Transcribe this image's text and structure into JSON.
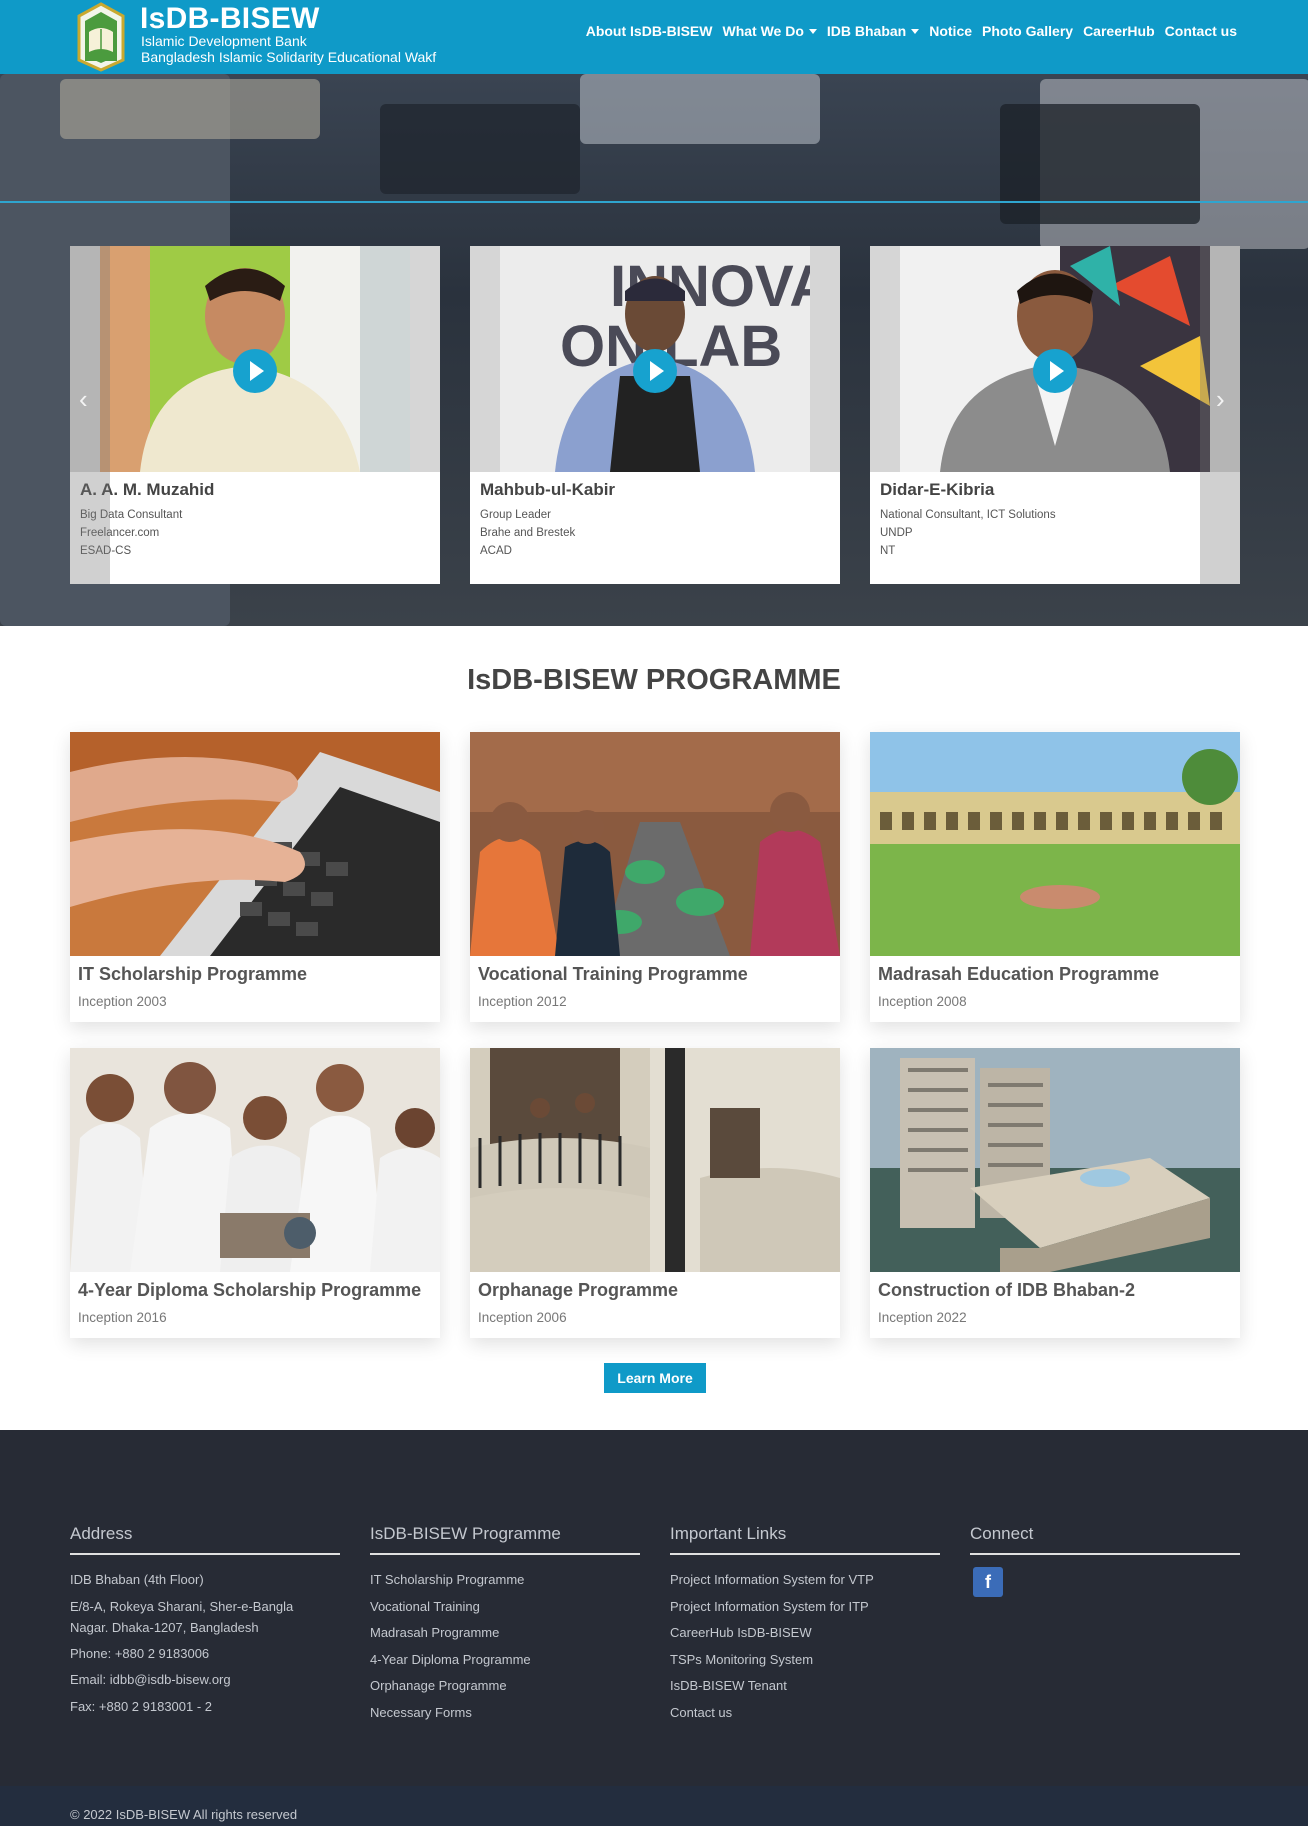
{
  "header": {
    "title": "IsDB-BISEW",
    "subtitle1": "Islamic Development Bank",
    "subtitle2": "Bangladesh Islamic Solidarity Educational Wakf",
    "logo_text": "IsDB-BISEW",
    "nav": [
      {
        "label": "About IsDB-BISEW",
        "dropdown": false
      },
      {
        "label": "What We Do",
        "dropdown": true
      },
      {
        "label": "IDB Bhaban",
        "dropdown": true
      },
      {
        "label": "Notice",
        "dropdown": false
      },
      {
        "label": "Photo Gallery",
        "dropdown": false
      },
      {
        "label": "CareerHub",
        "dropdown": false
      },
      {
        "label": "Contact us",
        "dropdown": false
      }
    ]
  },
  "testimonials": [
    {
      "name": "A. A. M. Muzahid",
      "lines": [
        "Big Data Consultant",
        "Freelancer.com",
        "ESAD-CS"
      ]
    },
    {
      "name": "Mahbub-ul-Kabir",
      "lines": [
        "Group Leader",
        "Brahe and Brestek",
        "ACAD"
      ]
    },
    {
      "name": "Didar-E-Kibria",
      "lines": [
        "National Consultant, ICT Solutions",
        "UNDP",
        "NT"
      ]
    }
  ],
  "carousel": {
    "prev_icon": "chevron-left-icon",
    "next_icon": "chevron-right-icon",
    "prev_glyph": "‹",
    "next_glyph": "›"
  },
  "programme": {
    "title": "IsDB-BISEW PROGRAMME",
    "cards": [
      {
        "title": "IT Scholarship Programme",
        "inception": "Inception 2003"
      },
      {
        "title": "Vocational Training Programme",
        "inception": "Inception 2012"
      },
      {
        "title": "Madrasah Education Programme",
        "inception": "Inception 2008"
      },
      {
        "title": "4-Year Diploma Scholarship Programme",
        "inception": "Inception 2016"
      },
      {
        "title": "Orphanage Programme",
        "inception": "Inception 2006"
      },
      {
        "title": "Construction of IDB Bhaban-2",
        "inception": "Inception 2022"
      }
    ],
    "learn_more": "Learn More"
  },
  "footer": {
    "address": {
      "heading": "Address",
      "lines": [
        "IDB Bhaban (4th Floor)",
        "E/8-A, Rokeya Sharani, Sher-e-Bangla",
        "Nagar. Dhaka-1207, Bangladesh",
        "Phone: +880 2 9183006",
        "Email: idbb@isdb-bisew.org",
        "Fax: +880 2 9183001 - 2"
      ]
    },
    "programme": {
      "heading": "IsDB-BISEW Programme",
      "links": [
        "IT Scholarship Programme",
        "Vocational Training",
        "Madrasah Programme",
        "4-Year Diploma Programme",
        "Orphanage Programme",
        "Necessary Forms"
      ]
    },
    "links": {
      "heading": "Important Links",
      "links": [
        "Project Information System for VTP",
        "Project Information System for ITP",
        "CareerHub IsDB-BISEW",
        "TSPs Monitoring System",
        "IsDB-BISEW Tenant",
        "Contact us"
      ]
    },
    "connect": {
      "heading": "Connect",
      "facebook_glyph": "f"
    },
    "copyright": "© 2022 IsDB-BISEW All rights reserved"
  },
  "colors": {
    "primary": "#0f9ac8",
    "footer_bg": "#272b35",
    "copyright_bg": "#232d3e",
    "facebook": "#3b6cb8"
  }
}
